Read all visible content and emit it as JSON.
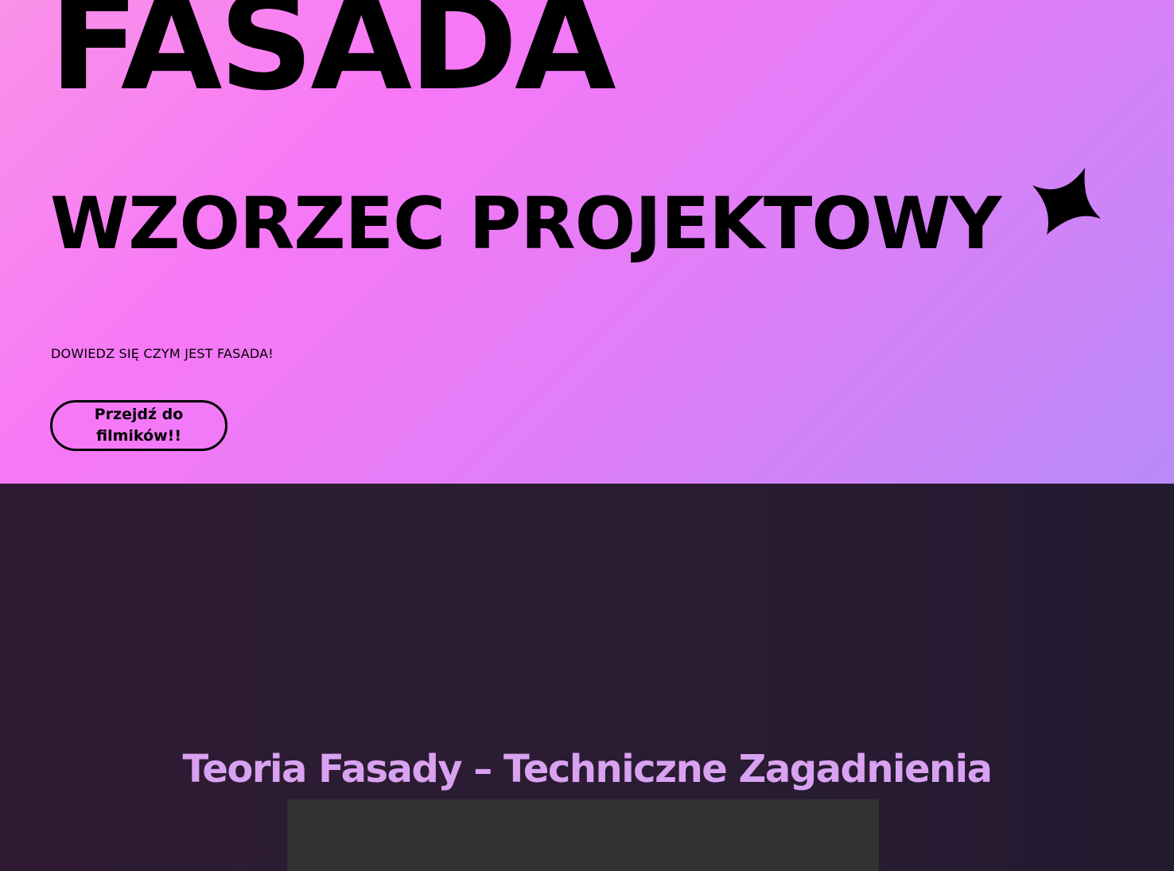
{
  "hero": {
    "title": "FASADA",
    "subtitle": "WZORZEC PROJEKTOWY",
    "tagline": "DOWIEDZ SIĘ CZYM JEST FASADA!",
    "cta_label": "Przejdź do filmików!!",
    "sparkle_icon": "four-point-star-icon"
  },
  "section": {
    "title": "Teoria Fasady – Techniczne Zagadnienia"
  },
  "colors": {
    "hero_gradient": [
      "#f992e8",
      "#f778f7",
      "#e07ef7",
      "#b98af7"
    ],
    "dark_background": "#2a1c33",
    "section_title": "#d9a2f0",
    "video_placeholder": "#323232"
  }
}
